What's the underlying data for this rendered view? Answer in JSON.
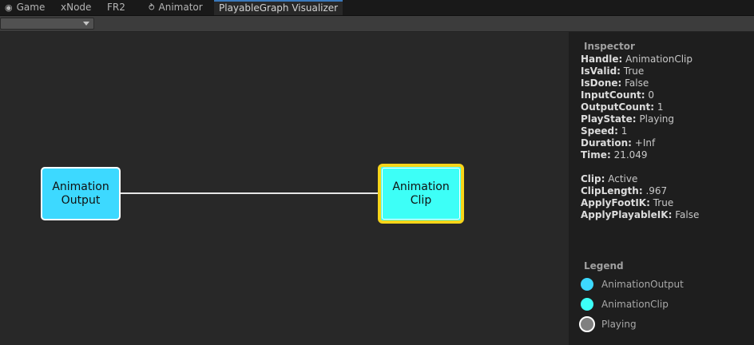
{
  "tabs": [
    {
      "label": "Game",
      "icon": "gamepad-icon"
    },
    {
      "label": "xNode"
    },
    {
      "label": "FR2"
    },
    {
      "label": "Animator",
      "icon": "animator-icon"
    },
    {
      "label": "PlayableGraph Visualizer",
      "active": true
    }
  ],
  "toolbar": {
    "graph_dropdown_value": ""
  },
  "graph": {
    "nodes": [
      {
        "label": "Animation\nOutput",
        "color": "#3dd9ff"
      },
      {
        "label": "Animation\nClip",
        "color": "#3dfff7",
        "selected": true,
        "selection_color": "#f7d51a"
      }
    ],
    "edge_color": "#e6e6e6"
  },
  "inspector": {
    "title": "Inspector",
    "properties": [
      {
        "key": "Handle:",
        "value": "AnimationClip"
      },
      {
        "key": "IsValid:",
        "value": "True"
      },
      {
        "key": "IsDone:",
        "value": "False"
      },
      {
        "key": "InputCount:",
        "value": "0"
      },
      {
        "key": "OutputCount:",
        "value": "1"
      },
      {
        "key": "PlayState:",
        "value": "Playing"
      },
      {
        "key": "Speed:",
        "value": "1"
      },
      {
        "key": "Duration:",
        "value": "+Inf"
      },
      {
        "key": "Time:",
        "value": "21.049"
      }
    ],
    "clip_properties": [
      {
        "key": "Clip:",
        "value": "Active"
      },
      {
        "key": "ClipLength:",
        "value": ".967"
      },
      {
        "key": "ApplyFootIK:",
        "value": "True"
      },
      {
        "key": "ApplyPlayableIK:",
        "value": "False"
      }
    ]
  },
  "legend": {
    "title": "Legend",
    "items": [
      {
        "label": "AnimationOutput",
        "color": "#3dd9ff"
      },
      {
        "label": "AnimationClip",
        "color": "#3dfff7"
      },
      {
        "label": "Playing",
        "color": "#808080",
        "border": "#ffffff"
      }
    ]
  }
}
